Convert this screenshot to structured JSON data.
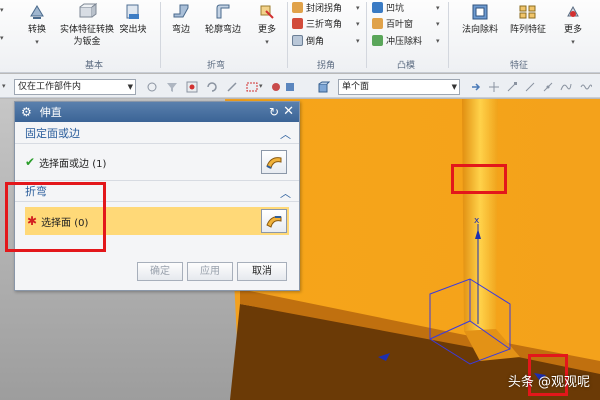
{
  "ribbon": {
    "buttons": {
      "convert": "转换",
      "solid_to_sheet": "实体特征转换为钣金",
      "break_corner": "突出块",
      "flange": "弯边",
      "contour_flange": "轮廓弯边",
      "more1": "更多",
      "normal_cutout": "法向除料",
      "pattern_feature": "阵列特征",
      "more2": "更多"
    },
    "small": {
      "closed_corner": "封闭拐角",
      "three_bend_corner": "三折弯角",
      "chamfer": "倒角",
      "dimple": "凹坑",
      "louver": "百叶窗",
      "drawn_cutout": "冲压除料"
    },
    "groups": {
      "basic": "基本",
      "bend": "折弯",
      "corner": "拐角",
      "convex": "凸模",
      "feature": "特征"
    }
  },
  "selection_bar": {
    "filter_scope": "仅在工作部件内",
    "face_rule": "单个面"
  },
  "dialog": {
    "title": "伸直",
    "section1": {
      "header": "固定面或边",
      "label": "选择面或边 (1)"
    },
    "section2": {
      "header": "折弯",
      "label": "选择面 (0)"
    },
    "buttons": {
      "ok": "确定",
      "apply": "应用",
      "cancel": "取消"
    }
  },
  "watermark": "头条 @观观呢",
  "colors": {
    "part": "#f4a21b",
    "highlight": "#ffd978",
    "annotation": "#e3171b",
    "titlebar": "#3b6496"
  }
}
